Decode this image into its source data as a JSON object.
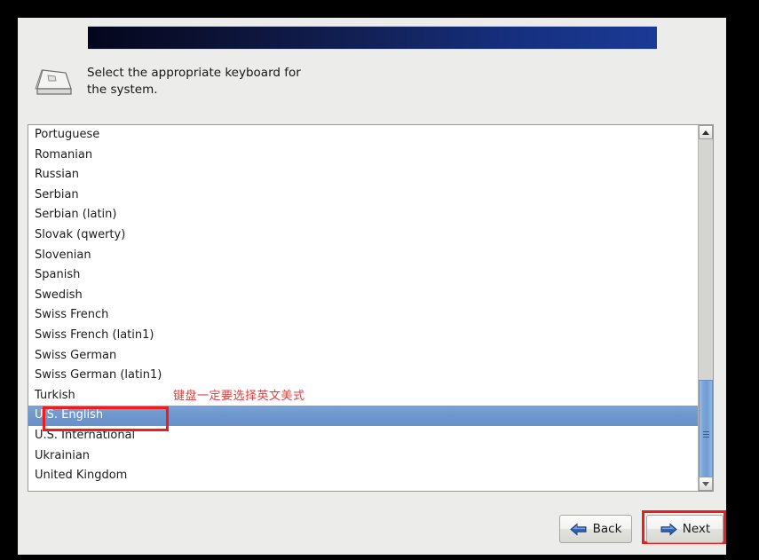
{
  "window": {
    "background_color": "#000000",
    "panel_color": "#ececeb"
  },
  "banner": {
    "gradient_from": "#04061c",
    "gradient_to": "#1b3a96"
  },
  "header": {
    "icon": "keyboard-key-icon",
    "instruction": "Select the appropriate keyboard for\nthe system."
  },
  "keyboard_list": {
    "selected_value": "U.S. English",
    "items": [
      {
        "label": "Portuguese",
        "selected": false
      },
      {
        "label": "Romanian",
        "selected": false
      },
      {
        "label": "Russian",
        "selected": false
      },
      {
        "label": "Serbian",
        "selected": false
      },
      {
        "label": "Serbian (latin)",
        "selected": false
      },
      {
        "label": "Slovak (qwerty)",
        "selected": false
      },
      {
        "label": "Slovenian",
        "selected": false
      },
      {
        "label": "Spanish",
        "selected": false
      },
      {
        "label": "Swedish",
        "selected": false
      },
      {
        "label": "Swiss French",
        "selected": false
      },
      {
        "label": "Swiss French (latin1)",
        "selected": false
      },
      {
        "label": "Swiss German",
        "selected": false
      },
      {
        "label": "Swiss German (latin1)",
        "selected": false
      },
      {
        "label": "Turkish",
        "selected": false
      },
      {
        "label": "U.S. English",
        "selected": true
      },
      {
        "label": "U.S. International",
        "selected": false
      },
      {
        "label": "Ukrainian",
        "selected": false
      },
      {
        "label": "United Kingdom",
        "selected": false
      }
    ],
    "highlight_color": "#6d97cd"
  },
  "scrollbar": {
    "up_icon": "chevron-up-icon",
    "down_icon": "chevron-down-icon",
    "thumb_color": "#7ba5d9",
    "grip_icon": "grip-lines-icon"
  },
  "annotations": {
    "note_text": "键盘一定要选择英文美式",
    "note_color": "#e23c3c",
    "box_color": "#ee1c1c",
    "selected_row_box_label": "annotation-box-selected-keyboard",
    "next_button_box_label": "annotation-box-next-button"
  },
  "buttons": {
    "back_label": "Back",
    "back_icon": "arrow-left-icon",
    "next_label": "Next",
    "next_icon": "arrow-right-icon"
  }
}
